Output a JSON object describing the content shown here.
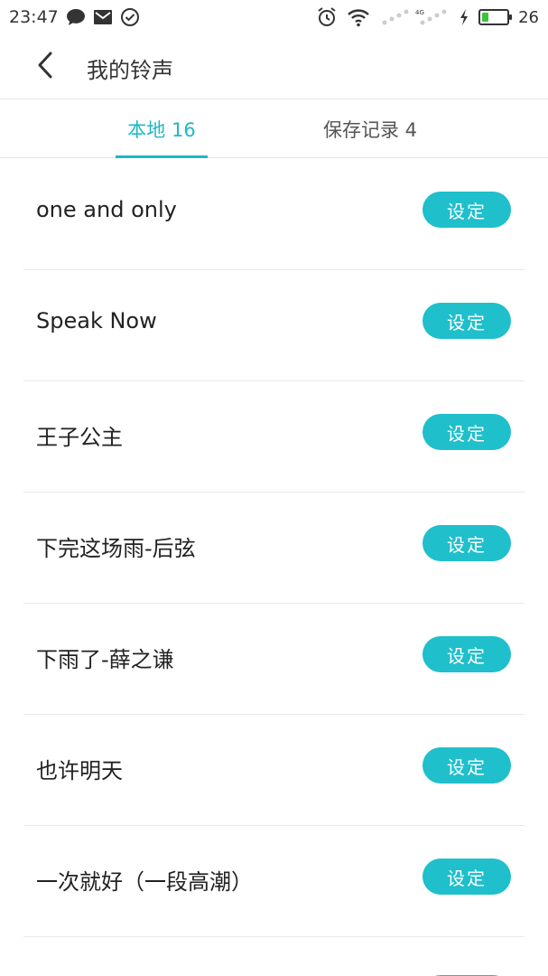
{
  "status_bar": {
    "time": "23:47",
    "battery_level": "26",
    "battery_fraction": 0.26,
    "icons": [
      "chat-bubble-icon",
      "mail-icon",
      "check-circle-icon",
      "alarm-icon",
      "wifi-icon",
      "signal-4g-icon",
      "charging-icon",
      "battery-icon"
    ]
  },
  "header": {
    "title": "我的铃声",
    "back_icon": "chevron-left-icon"
  },
  "tabs": [
    {
      "label": "本地 16",
      "active": true
    },
    {
      "label": "保存记录 4",
      "active": false
    }
  ],
  "accent_color": "#1fbfcb",
  "ringtones": [
    {
      "title": "one and only",
      "button": "设定"
    },
    {
      "title": "Speak Now",
      "button": "设定"
    },
    {
      "title": "王子公主",
      "button": "设定"
    },
    {
      "title": "下完这场雨-后弦",
      "button": "设定"
    },
    {
      "title": "下雨了-薛之谦",
      "button": "设定"
    },
    {
      "title": "也许明天",
      "button": "设定"
    },
    {
      "title": "一次就好（一段高潮）",
      "button": "设定"
    }
  ]
}
